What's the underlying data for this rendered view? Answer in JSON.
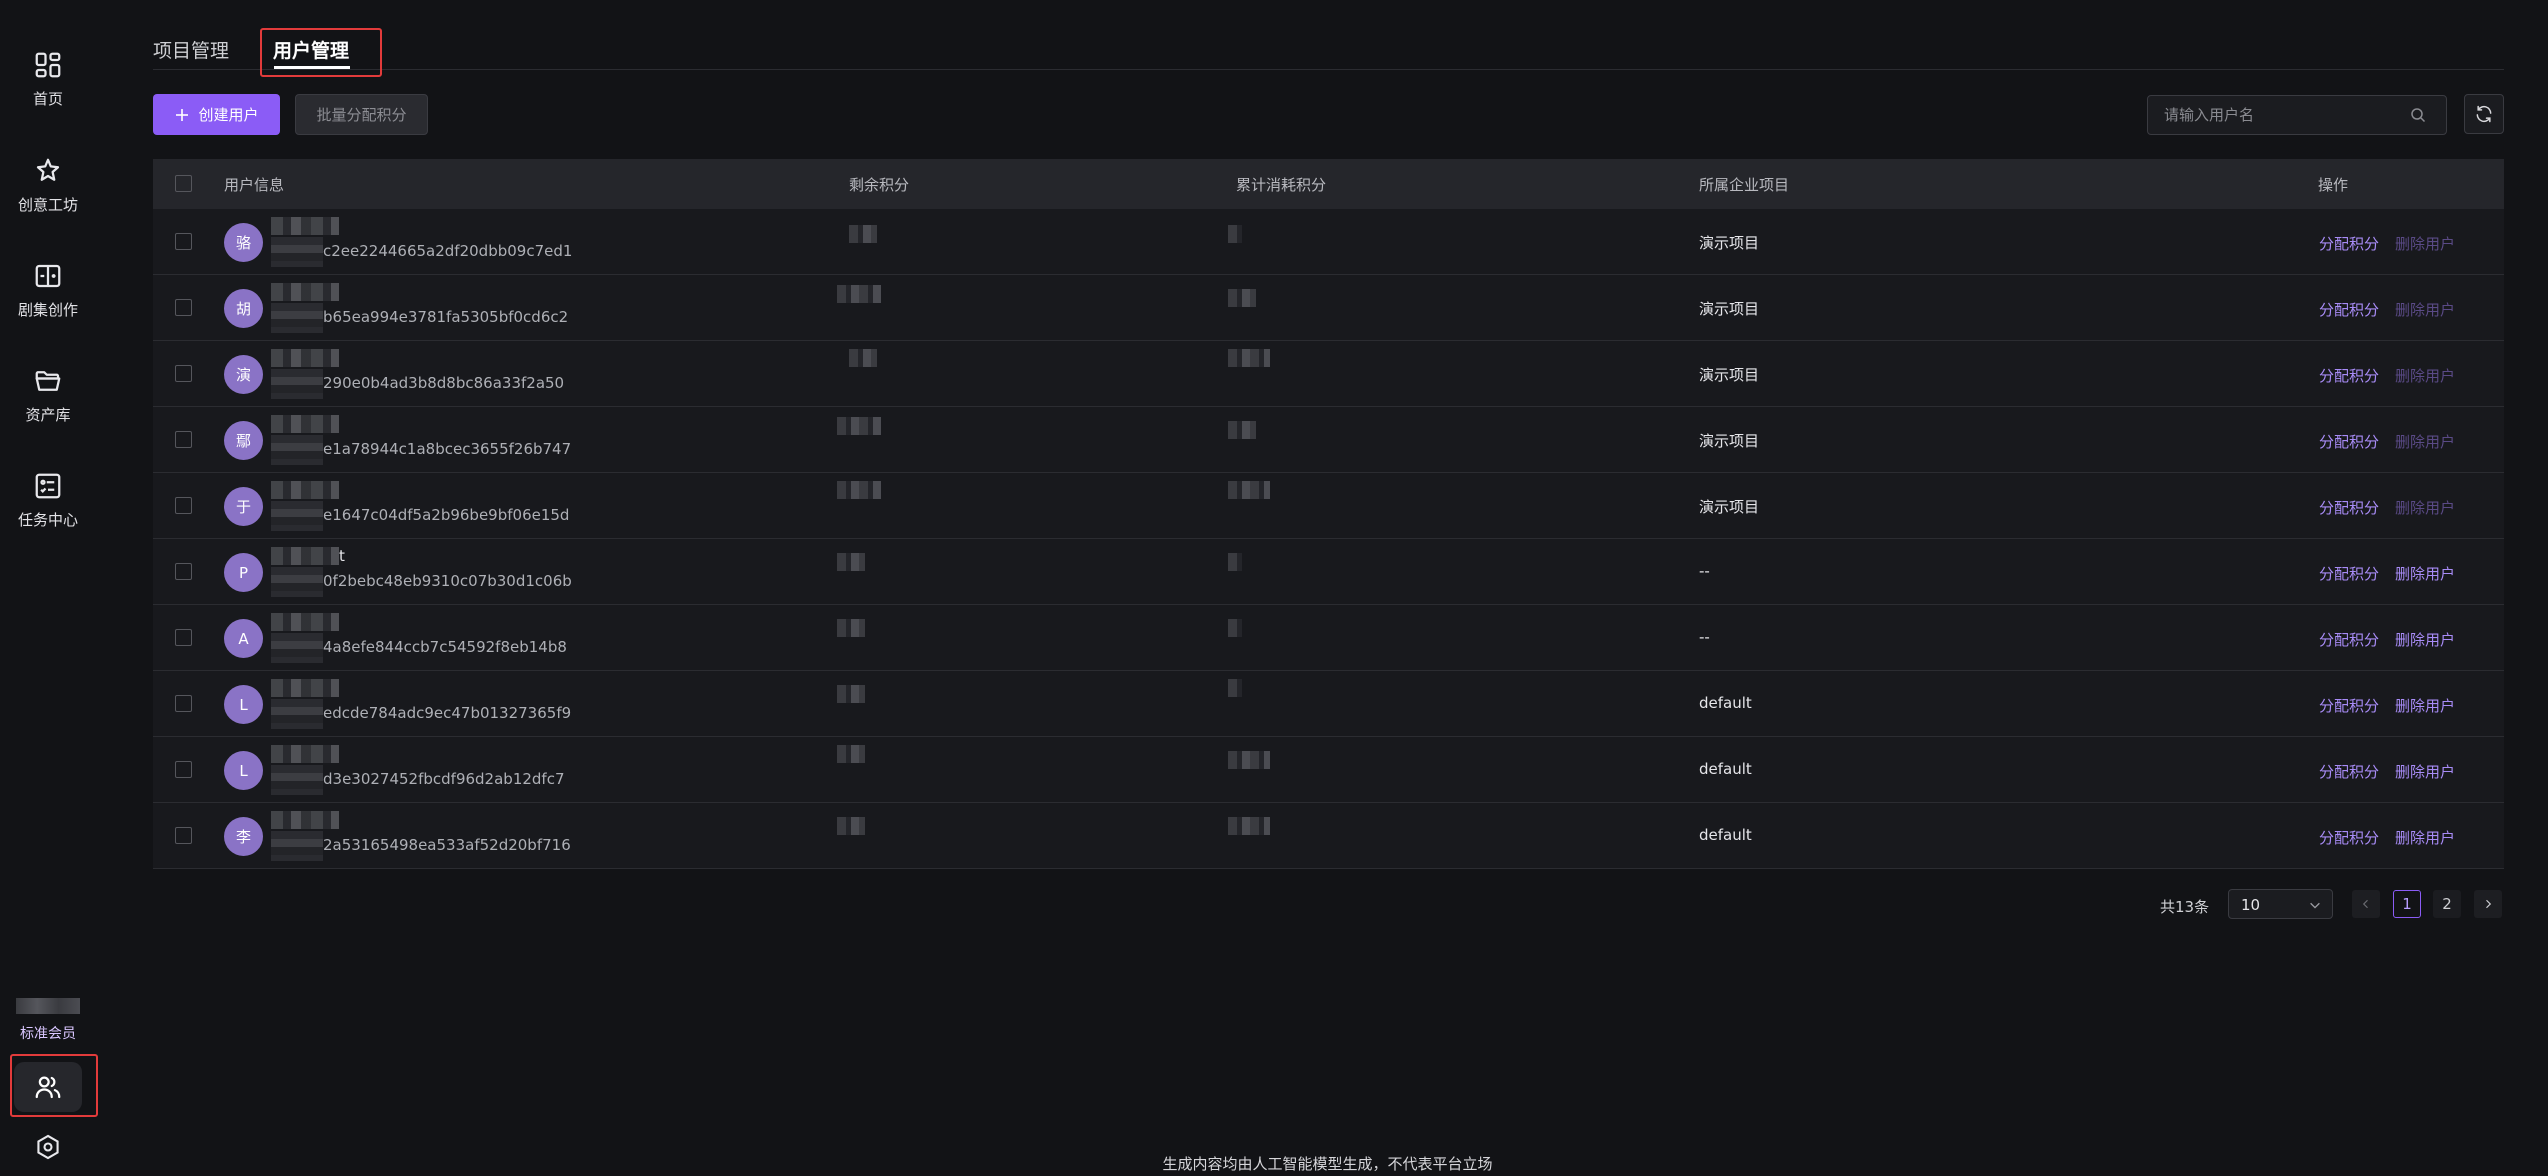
{
  "sidebar": {
    "items": [
      {
        "label": "首页",
        "icon": "grid-icon"
      },
      {
        "label": "创意工坊",
        "icon": "sparkle-icon"
      },
      {
        "label": "剧集创作",
        "icon": "book-plus-icon"
      },
      {
        "label": "资产库",
        "icon": "folder-icon"
      },
      {
        "label": "任务中心",
        "icon": "task-list-icon"
      }
    ],
    "member_label": "标准会员"
  },
  "tabs": [
    {
      "label": "项目管理",
      "active": false
    },
    {
      "label": "用户管理",
      "active": true
    }
  ],
  "toolbar": {
    "create_label": "创建用户",
    "batch_label": "批量分配积分",
    "search_placeholder": "请输入用户名"
  },
  "table": {
    "headers": {
      "user": "用户信息",
      "remaining": "剩余积分",
      "consumed": "累计消耗积分",
      "project": "所属企业项目",
      "actions": "操作"
    },
    "rows": [
      {
        "initial": "骆",
        "name_tail": "",
        "uid": "c2ee2244665a2df20dbb09c7ed1",
        "project": "演示项目",
        "assign": "分配积分",
        "delete": "删除用户",
        "delete_disabled": true
      },
      {
        "initial": "胡",
        "name_tail": "",
        "uid": "b65ea994e3781fa5305bf0cd6c2",
        "project": "演示项目",
        "assign": "分配积分",
        "delete": "删除用户",
        "delete_disabled": true
      },
      {
        "initial": "演",
        "name_tail": "",
        "uid": "290e0b4ad3b8d8bc86a33f2a50",
        "project": "演示项目",
        "assign": "分配积分",
        "delete": "删除用户",
        "delete_disabled": true
      },
      {
        "initial": "鄢",
        "name_tail": "",
        "uid": "e1a78944c1a8bcec3655f26b747",
        "project": "演示项目",
        "assign": "分配积分",
        "delete": "删除用户",
        "delete_disabled": true
      },
      {
        "initial": "于",
        "name_tail": "",
        "uid": "e1647c04df5a2b96be9bf06e15d",
        "project": "演示项目",
        "assign": "分配积分",
        "delete": "删除用户",
        "delete_disabled": true
      },
      {
        "initial": "P",
        "name_tail": "t",
        "uid": "0f2bebc48eb9310c07b30d1c06b",
        "project": "--",
        "assign": "分配积分",
        "delete": "删除用户",
        "delete_disabled": false
      },
      {
        "initial": "A",
        "name_tail": "",
        "uid": "4a8efe844ccb7c54592f8eb14b8",
        "project": "--",
        "assign": "分配积分",
        "delete": "删除用户",
        "delete_disabled": false
      },
      {
        "initial": "L",
        "name_tail": "",
        "uid": "edcde784adc9ec47b01327365f9",
        "project": "default",
        "assign": "分配积分",
        "delete": "删除用户",
        "delete_disabled": false
      },
      {
        "initial": "L",
        "name_tail": "",
        "uid": "d3e3027452fbcdf96d2ab12dfc7",
        "project": "default",
        "assign": "分配积分",
        "delete": "删除用户",
        "delete_disabled": false
      },
      {
        "initial": "李",
        "name_tail": "",
        "uid": "2a53165498ea533af52d20bf716",
        "project": "default",
        "assign": "分配积分",
        "delete": "删除用户",
        "delete_disabled": false
      }
    ]
  },
  "pagination": {
    "total": "共13条",
    "page_size": "10",
    "pages": [
      "1",
      "2"
    ],
    "current": "1"
  },
  "footer": "生成内容均由人工智能模型生成，不代表平台立场",
  "colors": {
    "accent": "#8b5cf6",
    "link": "#a88cf7",
    "avatar": "#8a73c6",
    "highlight": "#e23b3b"
  }
}
